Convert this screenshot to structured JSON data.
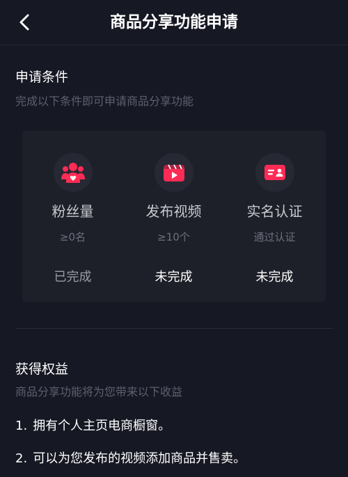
{
  "header": {
    "title": "商品分享功能申请",
    "back_icon": "chevron-left-icon"
  },
  "conditions": {
    "title": "申请条件",
    "subtitle": "完成以下条件即可申请商品分享功能",
    "items": [
      {
        "icon": "fans-icon",
        "label": "粉丝量",
        "requirement": "≥0名",
        "status": "已完成",
        "completed": true
      },
      {
        "icon": "video-icon",
        "label": "发布视频",
        "requirement": "≥10个",
        "status": "未完成",
        "completed": false
      },
      {
        "icon": "id-card-icon",
        "label": "实名认证",
        "requirement": "通过认证",
        "status": "未完成",
        "completed": false
      }
    ]
  },
  "benefits": {
    "title": "获得权益",
    "subtitle": "商品分享功能将为您带来以下收益",
    "items": [
      {
        "num": "1.",
        "text": "拥有个人主页电商橱窗。"
      },
      {
        "num": "2.",
        "text": "可以为您发布的视频添加商品并售卖。"
      }
    ]
  },
  "colors": {
    "background": "#161823",
    "accent": "#fe2c55",
    "card": "#1e2029"
  }
}
